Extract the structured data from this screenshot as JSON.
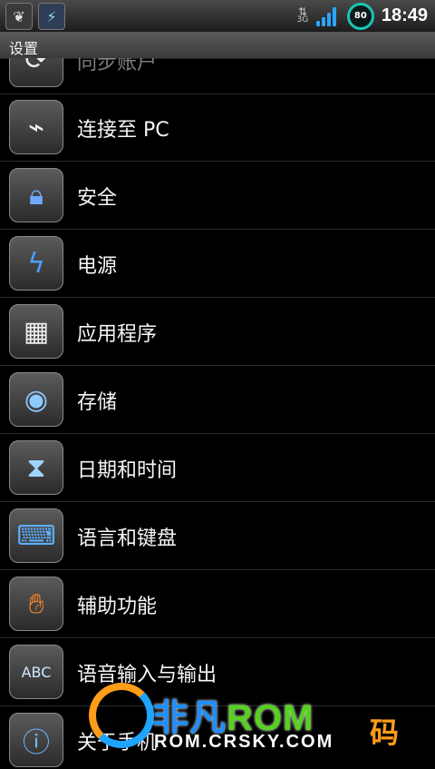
{
  "status_bar": {
    "left_icons": [
      "leaf-icon",
      "usb-icon"
    ],
    "data_indicator": "3G",
    "battery_level": "80",
    "time": "18:49",
    "colors": {
      "signal": "#2aa6ff",
      "battery_ring": "#19c6b3"
    }
  },
  "title_bar": {
    "title": "设置"
  },
  "settings": {
    "items": [
      {
        "label": "同步账户",
        "icon": "sync-icon"
      },
      {
        "label": "连接至 PC",
        "icon": "usb-cable-icon"
      },
      {
        "label": "安全",
        "icon": "padlock-icon"
      },
      {
        "label": "电源",
        "icon": "battery-power-icon"
      },
      {
        "label": "应用程序",
        "icon": "apps-grid-icon"
      },
      {
        "label": "存储",
        "icon": "storage-disk-icon"
      },
      {
        "label": "日期和时间",
        "icon": "hourglass-icon"
      },
      {
        "label": "语言和键盘",
        "icon": "keyboard-icon"
      },
      {
        "label": "辅助功能",
        "icon": "hand-icon"
      },
      {
        "label": "语音输入与输出",
        "icon": "speech-bubble-icon"
      },
      {
        "label": "关于手机",
        "icon": "info-icon"
      }
    ]
  },
  "watermark": {
    "brand": "非凡",
    "rom": "ROM",
    "url": "ROM.CRSKY.COM",
    "right_text": "码"
  }
}
